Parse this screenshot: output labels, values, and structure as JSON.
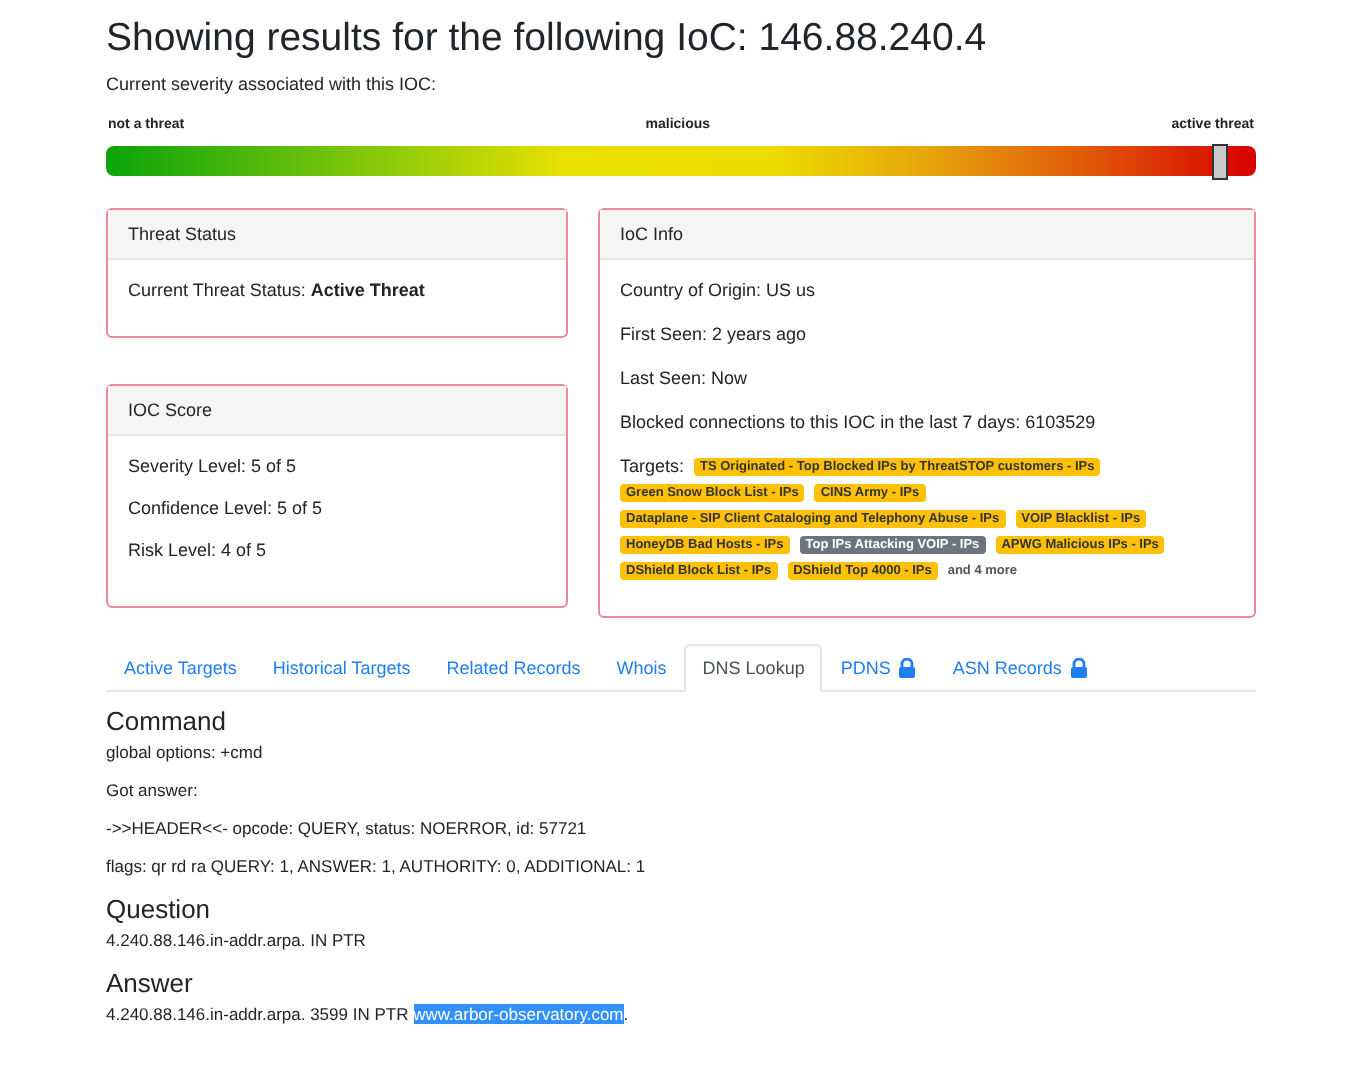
{
  "title": "Showing results for the following IoC: 146.88.240.4",
  "severity": {
    "caption": "Current severity associated with this IOC:",
    "labels": [
      "not a threat",
      "malicious",
      "active threat"
    ],
    "level": 0.967
  },
  "threat_status": {
    "header": "Threat Status",
    "label": "Current Threat Status: ",
    "value": "Active Threat"
  },
  "ioc_score": {
    "header": "IOC Score",
    "lines": [
      "Severity Level: 5 of 5",
      "Confidence Level: 5 of 5",
      "Risk Level: 4 of 5"
    ]
  },
  "ioc_info": {
    "header": "IoC Info",
    "lines": [
      "Country of Origin: US us",
      "First Seen: 2 years ago",
      "Last Seen: Now",
      "Blocked connections to this IOC in the last 7 days: 6103529"
    ],
    "targets_label": "Targets:",
    "targets": [
      {
        "label": "TS Originated - Top Blocked IPs by ThreatSTOP customers - IPs",
        "color": "#ffc107"
      },
      {
        "label": "Green Snow Block List - IPs",
        "color": "#ffc107"
      },
      {
        "label": "CINS Army - IPs",
        "color": "#ffc107"
      },
      {
        "label": "Dataplane - SIP Client Cataloging and Telephony Abuse - IPs",
        "color": "#ffc107"
      },
      {
        "label": "VOIP Blacklist - IPs",
        "color": "#ffc107"
      },
      {
        "label": "HoneyDB Bad Hosts - IPs",
        "color": "#ffc107"
      },
      {
        "label": "Top IPs Attacking VOIP - IPs",
        "color": "#6c757d"
      },
      {
        "label": "APWG Malicious IPs - IPs",
        "color": "#ffc107"
      },
      {
        "label": "DShield Block List - IPs",
        "color": "#ffc107"
      },
      {
        "label": "DShield Top 4000 - IPs",
        "color": "#ffc107"
      }
    ],
    "more": "and 4 more"
  },
  "tabs": [
    {
      "label": "Active Targets",
      "selected": false,
      "locked": false
    },
    {
      "label": "Historical Targets",
      "selected": false,
      "locked": false
    },
    {
      "label": "Related Records",
      "selected": false,
      "locked": false
    },
    {
      "label": "Whois",
      "selected": false,
      "locked": false
    },
    {
      "label": "DNS Lookup",
      "selected": true,
      "locked": false
    },
    {
      "label": "PDNS",
      "selected": false,
      "locked": true
    },
    {
      "label": "ASN Records",
      "selected": false,
      "locked": true
    }
  ],
  "sections": [
    {
      "heading": "Command",
      "lines": [
        {
          "text": "global options: +cmd"
        },
        {
          "text": "Got answer:"
        },
        {
          "text": "->>HEADER<<- opcode: QUERY, status: NOERROR, id: 57721"
        },
        {
          "text": "flags: qr rd ra QUERY: 1, ANSWER: 1, AUTHORITY: 0, ADDITIONAL: 1"
        }
      ]
    },
    {
      "heading": "Question",
      "lines": [
        {
          "text": "4.240.88.146.in-addr.arpa. IN PTR"
        }
      ]
    },
    {
      "heading": "Answer",
      "lines": [
        {
          "text": "4.240.88.146.in-addr.arpa. 3599 IN PTR ",
          "link": {
            "text": "www.arbor-observatory.com",
            "selected": true
          },
          "after": "."
        }
      ]
    }
  ]
}
